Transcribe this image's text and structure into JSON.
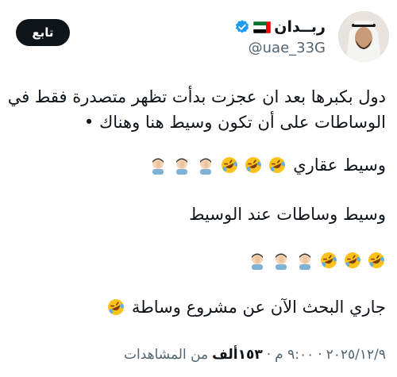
{
  "author": {
    "display_name": "ربــدان",
    "handle": "@uae_33G",
    "verified": true,
    "flag": "uae-flag-icon"
  },
  "actions": {
    "follow_label": "تابع"
  },
  "tweet": {
    "line1": "دول بكبرها بعد ان عجزت بدأت تظهر  متصدرة فقط في",
    "line2": "الوساطات على أن تكون وسيط هنا وهناك •",
    "line3": "وسيط عقاري",
    "line4": "وسيط وساطات عند الوسيط",
    "line5": "جاري البحث الآن عن مشروع وساطة"
  },
  "meta": {
    "date": "٢٠٢٥/١٢/٩",
    "separator1": "·",
    "time": "٩:٠٠ م",
    "separator2": "·",
    "views_count": "١٥٣ألف",
    "views_label": "من المشاهدات"
  },
  "colors": {
    "text": "#0f1419",
    "secondary": "#536471",
    "verified": "#1d9bf0",
    "follow_bg": "#0f1419"
  }
}
